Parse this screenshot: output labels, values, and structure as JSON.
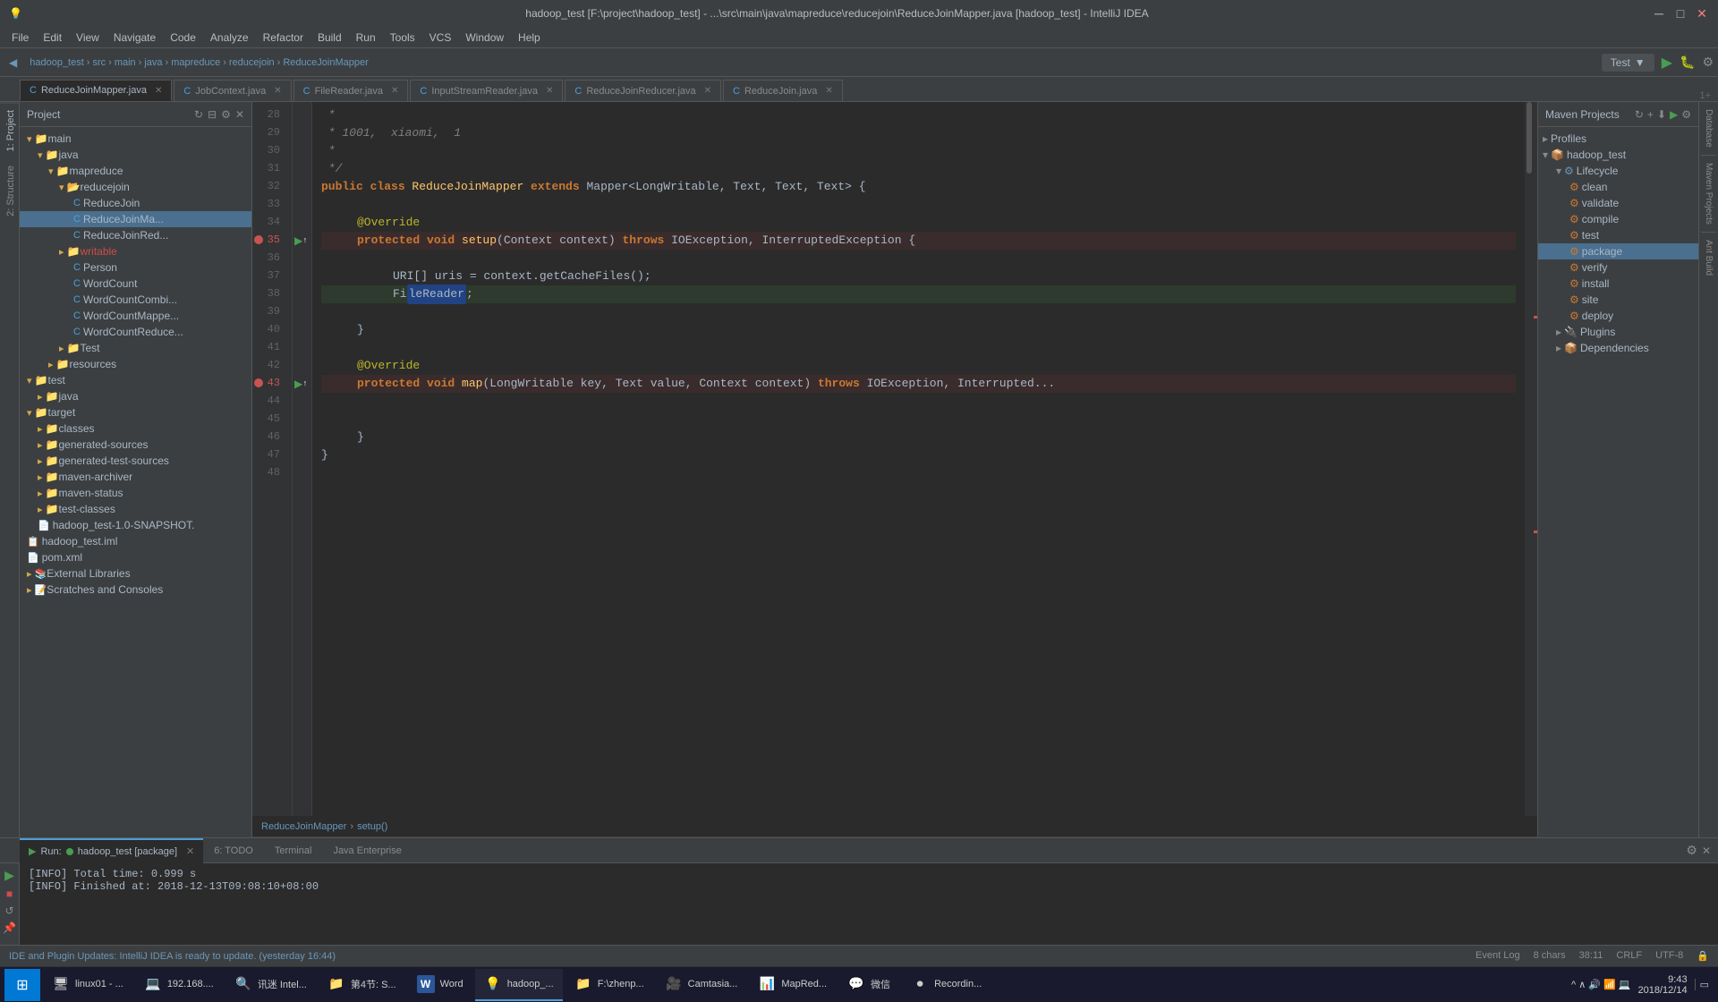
{
  "window": {
    "title": "hadoop_test [F:\\project\\hadoop_test] - ...\\src\\main\\java\\mapreduce\\reducejoin\\ReduceJoinMapper.java [hadoop_test] - IntelliJ IDEA",
    "controls": [
      "minimize",
      "maximize",
      "close"
    ]
  },
  "menu": {
    "items": [
      "File",
      "Edit",
      "View",
      "Navigate",
      "Code",
      "Analyze",
      "Refactor",
      "Build",
      "Run",
      "Tools",
      "VCS",
      "Window",
      "Help"
    ]
  },
  "toolbar": {
    "project_name": "hadoop_test",
    "run_config": "Test",
    "run_label": "Test"
  },
  "breadcrumb": {
    "items": [
      "hadoop_test",
      "src",
      "main",
      "java",
      "mapreduce",
      "reducejoin",
      "ReduceJoinMapper"
    ]
  },
  "tabs": [
    {
      "label": "ReduceJoinMapper.java",
      "active": true,
      "icon": "java"
    },
    {
      "label": "JobContext.java",
      "active": false,
      "icon": "java"
    },
    {
      "label": "FileReader.java",
      "active": false,
      "icon": "java"
    },
    {
      "label": "InputStreamReader.java",
      "active": false,
      "icon": "java"
    },
    {
      "label": "ReduceJoinReducer.java",
      "active": false,
      "icon": "java"
    },
    {
      "label": "ReduceJoin.java",
      "active": false,
      "icon": "java"
    }
  ],
  "file_tree": {
    "project_label": "Project",
    "items": [
      {
        "level": 0,
        "type": "folder",
        "label": "main",
        "expanded": true
      },
      {
        "level": 1,
        "type": "folder",
        "label": "java",
        "expanded": true
      },
      {
        "level": 2,
        "type": "folder",
        "label": "mapreduce",
        "expanded": true
      },
      {
        "level": 3,
        "type": "folder",
        "label": "reducejoin",
        "expanded": true
      },
      {
        "level": 4,
        "type": "java",
        "label": "ReduceJoin",
        "expanded": false
      },
      {
        "level": 4,
        "type": "java",
        "label": "ReduceJoinMapper",
        "expanded": false,
        "selected": true
      },
      {
        "level": 4,
        "type": "java",
        "label": "ReduceJoinReducer",
        "expanded": false
      },
      {
        "level": 2,
        "type": "folder",
        "label": "writable",
        "expanded": false
      },
      {
        "level": 3,
        "type": "java",
        "label": "Person",
        "expanded": false
      },
      {
        "level": 3,
        "type": "java",
        "label": "WordCount",
        "expanded": false
      },
      {
        "level": 3,
        "type": "java",
        "label": "WordCountCombi",
        "expanded": false
      },
      {
        "level": 3,
        "type": "java",
        "label": "WordCountMapper",
        "expanded": false
      },
      {
        "level": 3,
        "type": "java",
        "label": "WordCountReduce",
        "expanded": false
      },
      {
        "level": 2,
        "type": "folder",
        "label": "Test",
        "expanded": false
      },
      {
        "level": 1,
        "type": "folder",
        "label": "resources",
        "expanded": false
      },
      {
        "level": 0,
        "type": "folder",
        "label": "test",
        "expanded": true
      },
      {
        "level": 1,
        "type": "folder",
        "label": "java",
        "expanded": false
      },
      {
        "level": 0,
        "type": "folder",
        "label": "target",
        "expanded": true
      },
      {
        "level": 1,
        "type": "folder",
        "label": "classes",
        "expanded": false
      },
      {
        "level": 1,
        "type": "folder",
        "label": "generated-sources",
        "expanded": false
      },
      {
        "level": 1,
        "type": "folder",
        "label": "generated-test-sources",
        "expanded": false
      },
      {
        "level": 1,
        "type": "folder",
        "label": "maven-archiver",
        "expanded": false
      },
      {
        "level": 1,
        "type": "folder",
        "label": "maven-status",
        "expanded": false
      },
      {
        "level": 1,
        "type": "folder",
        "label": "test-classes",
        "expanded": false
      },
      {
        "level": 1,
        "type": "file",
        "label": "hadoop_test-1.0-SNAPSHOT.",
        "expanded": false
      },
      {
        "level": 0,
        "type": "iml",
        "label": "hadoop_test.iml",
        "expanded": false
      },
      {
        "level": 0,
        "type": "xml",
        "label": "pom.xml",
        "expanded": false
      },
      {
        "level": 0,
        "type": "folder",
        "label": "External Libraries",
        "expanded": false
      },
      {
        "level": 0,
        "type": "folder",
        "label": "Scratches and Consoles",
        "expanded": false
      }
    ]
  },
  "code": {
    "breadcrumb": "ReduceJoinMapper > setup()",
    "lines": [
      {
        "num": 28,
        "content": " * ",
        "type": "comment"
      },
      {
        "num": 29,
        "content": " * 1001,  xiaomi,  1",
        "type": "comment",
        "italic": true
      },
      {
        "num": 30,
        "content": " * ",
        "type": "comment"
      },
      {
        "num": 31,
        "content": " */",
        "type": "comment"
      },
      {
        "num": 32,
        "content": "public class ReduceJoinMapper extends Mapper<LongWritable, Text, Text, Text> {",
        "type": "code"
      },
      {
        "num": 33,
        "content": "",
        "type": "blank"
      },
      {
        "num": 34,
        "content": "    @Override",
        "type": "annotation"
      },
      {
        "num": 35,
        "content": "    protected void setup(Context context) throws IOException, InterruptedException {",
        "type": "code",
        "breakpoint": true,
        "arrow": true
      },
      {
        "num": 36,
        "content": "",
        "type": "blank"
      },
      {
        "num": 37,
        "content": "        URI[] uris = context.getCacheFiles();",
        "type": "code"
      },
      {
        "num": 38,
        "content": "        FileReader",
        "type": "code",
        "highlight": true,
        "selected": true
      },
      {
        "num": 39,
        "content": "",
        "type": "blank"
      },
      {
        "num": 40,
        "content": "    }",
        "type": "code"
      },
      {
        "num": 41,
        "content": "",
        "type": "blank"
      },
      {
        "num": 42,
        "content": "    @Override",
        "type": "annotation"
      },
      {
        "num": 43,
        "content": "    protected void map(LongWritable key, Text value, Context context) throws IOException, Interrupted",
        "type": "code",
        "breakpoint": true,
        "arrow": true
      },
      {
        "num": 44,
        "content": "",
        "type": "blank"
      },
      {
        "num": 45,
        "content": "",
        "type": "blank"
      },
      {
        "num": 46,
        "content": "    }",
        "type": "code"
      },
      {
        "num": 47,
        "content": "}",
        "type": "code"
      },
      {
        "num": 48,
        "content": "",
        "type": "blank"
      }
    ]
  },
  "maven": {
    "title": "Maven Projects",
    "sections": [
      {
        "label": "Profiles",
        "items": []
      },
      {
        "label": "hadoop_test",
        "expanded": true,
        "children": [
          {
            "label": "Lifecycle",
            "expanded": true,
            "children": [
              {
                "label": "clean",
                "selected": false
              },
              {
                "label": "validate",
                "selected": false
              },
              {
                "label": "compile",
                "selected": false
              },
              {
                "label": "test",
                "selected": false
              },
              {
                "label": "package",
                "selected": true
              },
              {
                "label": "verify",
                "selected": false
              },
              {
                "label": "install",
                "selected": false
              },
              {
                "label": "site",
                "selected": false
              },
              {
                "label": "deploy",
                "selected": false
              }
            ]
          },
          {
            "label": "Plugins",
            "expanded": false
          },
          {
            "label": "Dependencies",
            "expanded": false
          }
        ]
      }
    ]
  },
  "bottom_panel": {
    "run_config": "hadoop_test [package]",
    "tabs": [
      "4: Run",
      "6: TODO",
      "Terminal",
      "Java Enterprise"
    ],
    "active_tab": "4: Run",
    "output_lines": [
      "[INFO] Total time: 0.999 s",
      "[INFO] Finished at: 2018-12-13T09:08:10+08:00"
    ]
  },
  "status_bar": {
    "message": "IDE and Plugin Updates: IntelliJ IDEA is ready to update. (yesterday 16:44)",
    "chars": "8 chars",
    "position": "38:11",
    "line_separator": "CRLF",
    "encoding": "UTF-8"
  },
  "taskbar": {
    "time": "9:43",
    "date": "2018/12/14",
    "apps": [
      {
        "label": "linux01 - ...",
        "icon": "🖥",
        "active": false
      },
      {
        "label": "192.168....",
        "icon": "💻",
        "active": false
      },
      {
        "label": "讯迷 Intel...",
        "icon": "🔍",
        "active": false
      },
      {
        "label": "第4节: S...",
        "icon": "📁",
        "active": false
      },
      {
        "label": "Word",
        "icon": "W",
        "active": false,
        "color": "#2b579a"
      },
      {
        "label": "hadoop_...",
        "icon": "☕",
        "active": true
      },
      {
        "label": "F:\\zhenp...",
        "icon": "📁",
        "active": false
      },
      {
        "label": "Camtasia...",
        "icon": "🎥",
        "active": false
      },
      {
        "label": "MapRed...",
        "icon": "📊",
        "active": false
      },
      {
        "label": "微信",
        "icon": "💬",
        "active": false
      },
      {
        "label": "Recordin...",
        "icon": "⏺",
        "active": false
      }
    ]
  }
}
